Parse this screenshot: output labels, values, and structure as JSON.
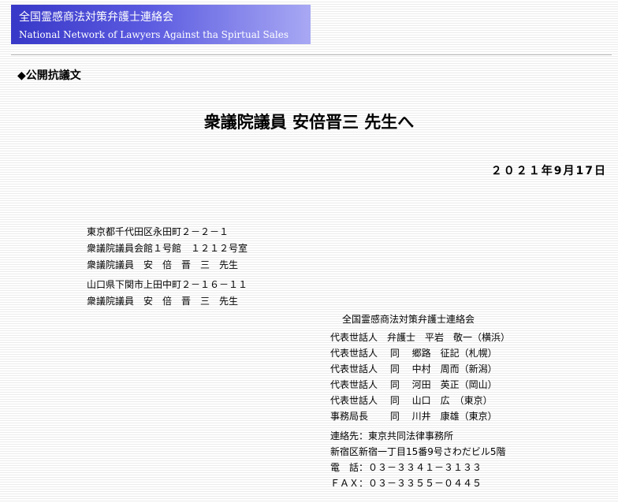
{
  "banner": {
    "title_jp": "全国霊感商法対策弁護士連絡会",
    "title_en": "National Network of Lawyers Against tha Spirtual Sales"
  },
  "section_label": "◆公開抗議文",
  "letter_title": "衆議院議員 安倍晋三 先生へ",
  "date": "２０２１年9月17日",
  "addressee": {
    "address1": "東京都千代田区永田町２－２－１",
    "address2": "衆議院議員会館１号館　１２１２号室",
    "name1": "衆議院議員　安　倍　晋　三　先生",
    "address3": "山口県下関市上田中町２－１６－１１",
    "name2": "衆議院議員　安　倍　晋　三　先生"
  },
  "sender": {
    "org": "全国霊感商法対策弁護士連絡会",
    "reps": [
      "代表世話人　弁護士　平岩　敬一（横浜）",
      "代表世話人　 同　 郷路　征記（札幌）",
      "代表世話人　 同　 中村　周而（新潟）",
      "代表世話人　 同　 河田　英正（岡山）",
      "代表世話人　 同　 山口　広　（東京）",
      "事務局長　　 同　 川井　康雄（東京）"
    ],
    "contact": {
      "label": "連絡先：東京共同法律事務所",
      "address": "新宿区新宿一丁目15番9号さわだビル5階",
      "phone": "電　話：０３－３３４１－３１３３",
      "fax": "ＦＡＸ：０３－３３５５－０４４５"
    }
  }
}
